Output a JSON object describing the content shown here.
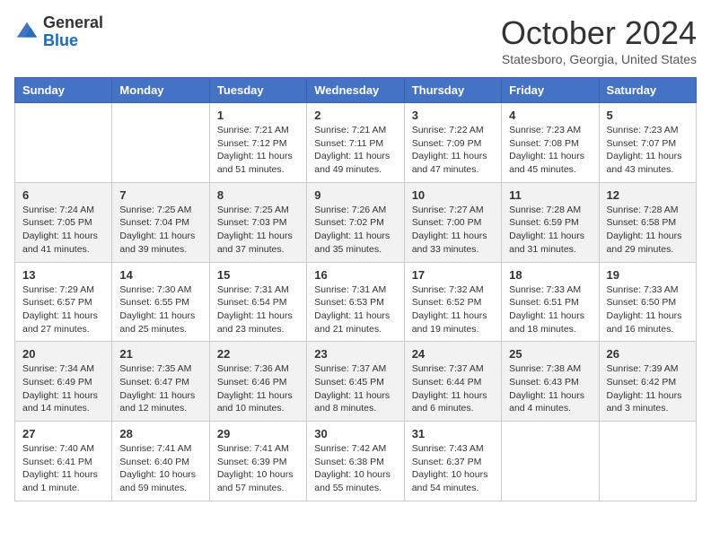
{
  "header": {
    "logo": {
      "general": "General",
      "blue": "Blue"
    },
    "title": "October 2024",
    "location": "Statesboro, Georgia, United States"
  },
  "days_of_week": [
    "Sunday",
    "Monday",
    "Tuesday",
    "Wednesday",
    "Thursday",
    "Friday",
    "Saturday"
  ],
  "weeks": [
    [
      null,
      null,
      {
        "day": 1,
        "sunrise": "7:21 AM",
        "sunset": "7:12 PM",
        "daylight": "11 hours and 51 minutes."
      },
      {
        "day": 2,
        "sunrise": "7:21 AM",
        "sunset": "7:11 PM",
        "daylight": "11 hours and 49 minutes."
      },
      {
        "day": 3,
        "sunrise": "7:22 AM",
        "sunset": "7:09 PM",
        "daylight": "11 hours and 47 minutes."
      },
      {
        "day": 4,
        "sunrise": "7:23 AM",
        "sunset": "7:08 PM",
        "daylight": "11 hours and 45 minutes."
      },
      {
        "day": 5,
        "sunrise": "7:23 AM",
        "sunset": "7:07 PM",
        "daylight": "11 hours and 43 minutes."
      }
    ],
    [
      {
        "day": 6,
        "sunrise": "7:24 AM",
        "sunset": "7:05 PM",
        "daylight": "11 hours and 41 minutes."
      },
      {
        "day": 7,
        "sunrise": "7:25 AM",
        "sunset": "7:04 PM",
        "daylight": "11 hours and 39 minutes."
      },
      {
        "day": 8,
        "sunrise": "7:25 AM",
        "sunset": "7:03 PM",
        "daylight": "11 hours and 37 minutes."
      },
      {
        "day": 9,
        "sunrise": "7:26 AM",
        "sunset": "7:02 PM",
        "daylight": "11 hours and 35 minutes."
      },
      {
        "day": 10,
        "sunrise": "7:27 AM",
        "sunset": "7:00 PM",
        "daylight": "11 hours and 33 minutes."
      },
      {
        "day": 11,
        "sunrise": "7:28 AM",
        "sunset": "6:59 PM",
        "daylight": "11 hours and 31 minutes."
      },
      {
        "day": 12,
        "sunrise": "7:28 AM",
        "sunset": "6:58 PM",
        "daylight": "11 hours and 29 minutes."
      }
    ],
    [
      {
        "day": 13,
        "sunrise": "7:29 AM",
        "sunset": "6:57 PM",
        "daylight": "11 hours and 27 minutes."
      },
      {
        "day": 14,
        "sunrise": "7:30 AM",
        "sunset": "6:55 PM",
        "daylight": "11 hours and 25 minutes."
      },
      {
        "day": 15,
        "sunrise": "7:31 AM",
        "sunset": "6:54 PM",
        "daylight": "11 hours and 23 minutes."
      },
      {
        "day": 16,
        "sunrise": "7:31 AM",
        "sunset": "6:53 PM",
        "daylight": "11 hours and 21 minutes."
      },
      {
        "day": 17,
        "sunrise": "7:32 AM",
        "sunset": "6:52 PM",
        "daylight": "11 hours and 19 minutes."
      },
      {
        "day": 18,
        "sunrise": "7:33 AM",
        "sunset": "6:51 PM",
        "daylight": "11 hours and 18 minutes."
      },
      {
        "day": 19,
        "sunrise": "7:33 AM",
        "sunset": "6:50 PM",
        "daylight": "11 hours and 16 minutes."
      }
    ],
    [
      {
        "day": 20,
        "sunrise": "7:34 AM",
        "sunset": "6:49 PM",
        "daylight": "11 hours and 14 minutes."
      },
      {
        "day": 21,
        "sunrise": "7:35 AM",
        "sunset": "6:47 PM",
        "daylight": "11 hours and 12 minutes."
      },
      {
        "day": 22,
        "sunrise": "7:36 AM",
        "sunset": "6:46 PM",
        "daylight": "11 hours and 10 minutes."
      },
      {
        "day": 23,
        "sunrise": "7:37 AM",
        "sunset": "6:45 PM",
        "daylight": "11 hours and 8 minutes."
      },
      {
        "day": 24,
        "sunrise": "7:37 AM",
        "sunset": "6:44 PM",
        "daylight": "11 hours and 6 minutes."
      },
      {
        "day": 25,
        "sunrise": "7:38 AM",
        "sunset": "6:43 PM",
        "daylight": "11 hours and 4 minutes."
      },
      {
        "day": 26,
        "sunrise": "7:39 AM",
        "sunset": "6:42 PM",
        "daylight": "11 hours and 3 minutes."
      }
    ],
    [
      {
        "day": 27,
        "sunrise": "7:40 AM",
        "sunset": "6:41 PM",
        "daylight": "11 hours and 1 minute."
      },
      {
        "day": 28,
        "sunrise": "7:41 AM",
        "sunset": "6:40 PM",
        "daylight": "10 hours and 59 minutes."
      },
      {
        "day": 29,
        "sunrise": "7:41 AM",
        "sunset": "6:39 PM",
        "daylight": "10 hours and 57 minutes."
      },
      {
        "day": 30,
        "sunrise": "7:42 AM",
        "sunset": "6:38 PM",
        "daylight": "10 hours and 55 minutes."
      },
      {
        "day": 31,
        "sunrise": "7:43 AM",
        "sunset": "6:37 PM",
        "daylight": "10 hours and 54 minutes."
      },
      null,
      null
    ]
  ]
}
